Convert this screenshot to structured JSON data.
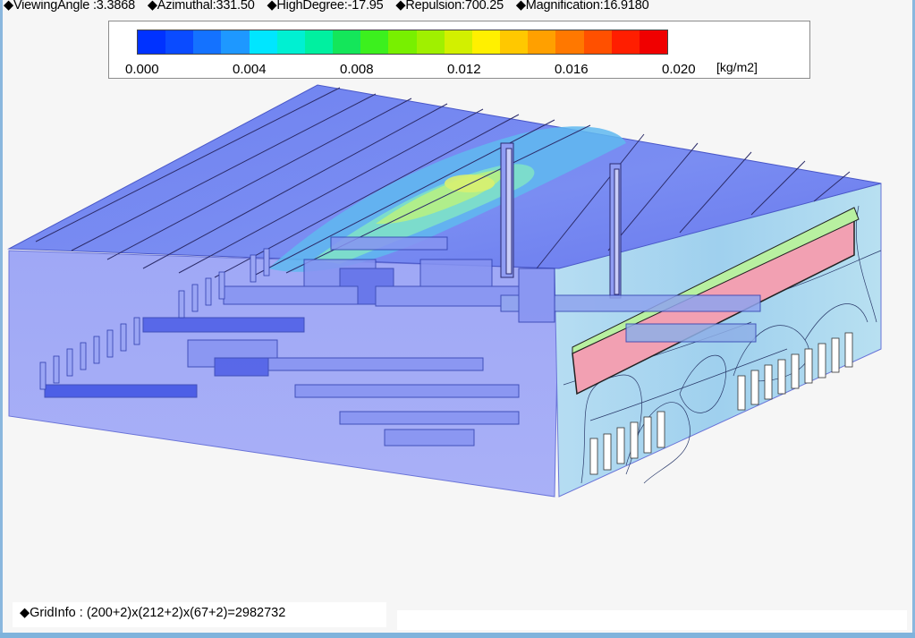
{
  "params": [
    "◆ViewingAngle :3.3868",
    "◆Azimuthal:331.50",
    "◆HighDegree:-17.95",
    "◆Repulsion:700.25",
    "◆Magnification:16.9180"
  ],
  "legend": {
    "ticks": [
      "0.000",
      "0.004",
      "0.008",
      "0.012",
      "0.016",
      "0.020"
    ],
    "unit": "[kg/m2]",
    "colors": [
      "#0032ff",
      "#0a4bff",
      "#1472ff",
      "#1e98ff",
      "#00e6ff",
      "#00f0d2",
      "#00f0a0",
      "#14e65a",
      "#3cf01e",
      "#78f000",
      "#a0f000",
      "#d2f000",
      "#fff000",
      "#ffc800",
      "#ffa000",
      "#ff7800",
      "#ff5000",
      "#ff1e00",
      "#f00000"
    ]
  },
  "footer": {
    "gridinfo": "◆GridInfo : (200+2)x(212+2)x(67+2)=2982732"
  }
}
